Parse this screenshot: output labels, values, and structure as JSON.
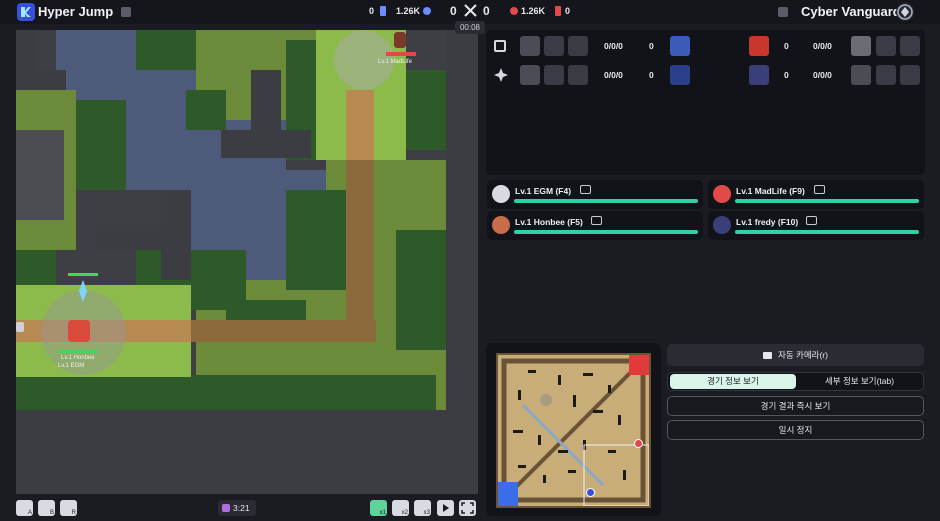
{
  "header": {
    "team_left": "Hyper Jump",
    "team_right": "Cyber Vanguard",
    "left_stat_a": "0",
    "left_stat_b": "1.26K",
    "score_left": "0",
    "score_right": "0",
    "right_stat_a": "1.26K",
    "right_stat_b": "0",
    "timer": "00:08",
    "colors": {
      "blue_team": "#4a6bff",
      "red_team": "#e24a4a",
      "accent": "#2fd1a6"
    }
  },
  "scoreboard": {
    "rows": [
      {
        "left_kda": "0/0/0",
        "left_cs": "0",
        "right_cs": "0",
        "right_kda": "0/0/0"
      },
      {
        "left_kda": "0/0/0",
        "left_cs": "0",
        "right_cs": "0",
        "right_kda": "0/0/0"
      }
    ]
  },
  "players": [
    {
      "name": "Lv.1 EGM (F4)",
      "hp": 1.0
    },
    {
      "name": "Lv.1 MadLife (F9)",
      "hp": 1.0
    },
    {
      "name": "Lv.1 Honbee (F5)",
      "hp": 1.0
    },
    {
      "name": "Lv.1 fredy (F10)",
      "hp": 1.0
    }
  ],
  "map_labels": {
    "ally_label_1": "Lv.1 Honbee",
    "ally_label_2": "Lv.1 EGM",
    "enemy_label": "Lv.1 MadLife"
  },
  "controls": {
    "auto_camera": "자동 카메라(r)",
    "tab_game_info": "경기 정보 보기",
    "tab_detail_info": "세부 정보 보기(tab)",
    "show_result": "경기 결과 즉시 보기",
    "pause": "일시 정지",
    "game_time": "3:21",
    "hotkeys": [
      "A",
      "B",
      "R"
    ],
    "speeds": [
      "x1",
      "x2",
      "x3"
    ]
  }
}
